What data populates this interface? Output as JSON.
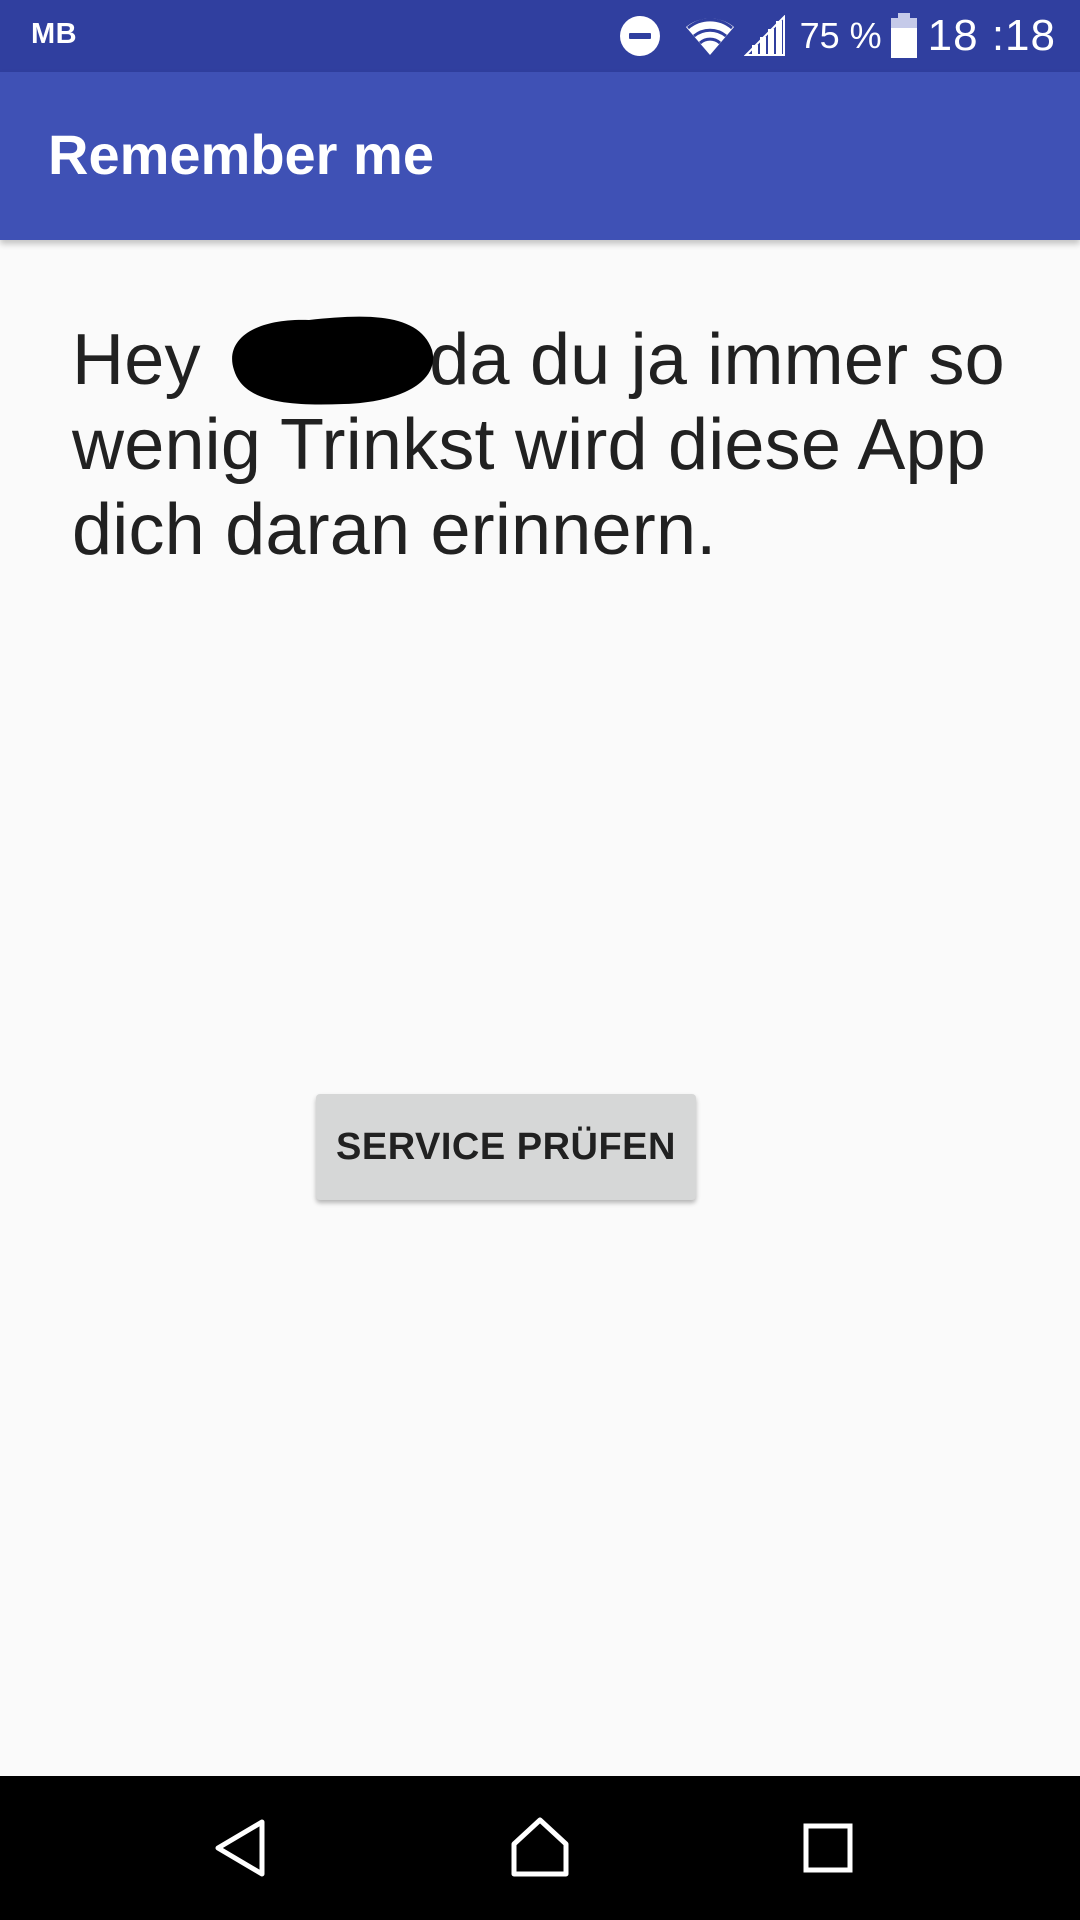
{
  "status_bar": {
    "carrier": "MB",
    "battery_percent": "75 %",
    "clock": "18 :18",
    "icons": [
      "do-not-disturb-icon",
      "wifi-icon",
      "cell-signal-icon",
      "battery-icon"
    ]
  },
  "app_bar": {
    "title": "Remember me",
    "color": "#3f51b5",
    "status_color": "#303f9f"
  },
  "content": {
    "greeting_prefix": "Hey ",
    "greeting_rest": ", da du ja immer so wenig Trinkst wird diese App dich daran erinnern.",
    "redaction": "redacted-name",
    "button_label": "SERVICE PRÜFEN"
  },
  "nav_bar": {
    "icons": [
      "back-icon",
      "home-icon",
      "recents-icon"
    ]
  }
}
